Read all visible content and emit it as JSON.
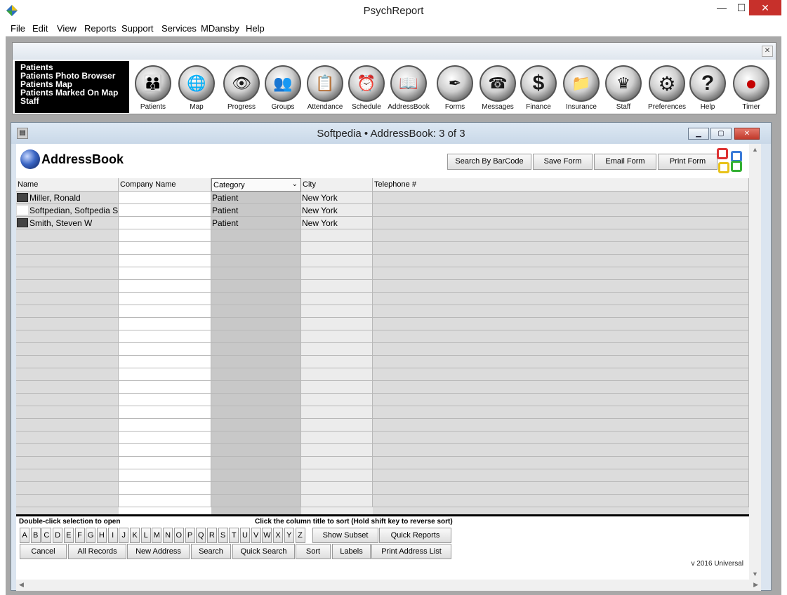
{
  "window": {
    "title": "PsychReport"
  },
  "menu": [
    "File",
    "Edit",
    "View",
    "Reports",
    "Support",
    "Services",
    "MDansby",
    "Help"
  ],
  "quicklinks": [
    "Patients",
    "Patients Photo Browser",
    "Patients Map",
    "Patients Marked On Map",
    "Staff"
  ],
  "toolbar": [
    {
      "label": "Patients",
      "glyph": "👪"
    },
    {
      "label": "Map",
      "glyph": "🌐"
    },
    {
      "label": "Progress",
      "glyph": "👁"
    },
    {
      "label": "Groups",
      "glyph": "👥"
    },
    {
      "label": "Attendance",
      "glyph": "📋"
    },
    {
      "label": "Schedule",
      "glyph": "⏰"
    },
    {
      "label": "AddressBook",
      "glyph": "📖"
    },
    {
      "label": "Forms",
      "glyph": "✒"
    },
    {
      "label": "Messages",
      "glyph": "☎"
    },
    {
      "label": "Finance",
      "glyph": "$"
    },
    {
      "label": "Insurance",
      "glyph": "📁"
    },
    {
      "label": "Staff",
      "glyph": "♛"
    },
    {
      "label": "Preferences",
      "glyph": "⚙"
    },
    {
      "label": "Help",
      "glyph": "?"
    },
    {
      "label": "Timer",
      "glyph": "●"
    }
  ],
  "inner_window": {
    "title": "Softpedia  •  AddressBook: 3 of 3",
    "heading": "AddressBook",
    "buttons": {
      "barcode": "Search By BarCode",
      "save": "Save Form",
      "email": "Email Form",
      "print": "Print Form"
    }
  },
  "table": {
    "columns": [
      "Name",
      "Company Name",
      "Category",
      "City",
      "Telephone #"
    ],
    "rows": [
      {
        "name": "Miller, Ronald",
        "company": "",
        "category": "Patient",
        "city": "New York",
        "phone": ""
      },
      {
        "name": "Softpedian, Softpedia S",
        "company": "",
        "category": "Patient",
        "city": "New York",
        "phone": ""
      },
      {
        "name": "Smith, Steven W",
        "company": "",
        "category": "Patient",
        "city": "New York",
        "phone": ""
      }
    ]
  },
  "bottom": {
    "hint_left": "Double-click selection to open",
    "hint_right": "Click the column title to sort  (Hold shift key to reverse sort)",
    "letters": [
      "A",
      "B",
      "C",
      "D",
      "E",
      "F",
      "G",
      "H",
      "I",
      "J",
      "K",
      "L",
      "M",
      "N",
      "O",
      "P",
      "Q",
      "R",
      "S",
      "T",
      "U",
      "V",
      "W",
      "X",
      "Y",
      "Z"
    ],
    "show_subset": "Show Subset",
    "quick_reports": "Quick Reports",
    "actions": [
      "Cancel",
      "All Records",
      "New Address",
      "Search",
      "Quick Search",
      "Sort",
      "Labels",
      "Print Address List"
    ],
    "version": "v 2016 Universal"
  }
}
